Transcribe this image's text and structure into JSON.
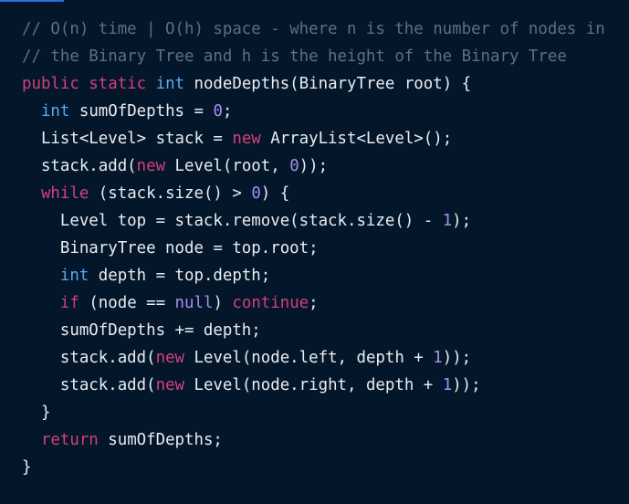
{
  "colors": {
    "background": "#04162a",
    "accent_bar": "#2a6fd6",
    "comment": "#5f6f7f",
    "keyword": "#d2417a",
    "type": "#5aa8f0",
    "number": "#a88ef0",
    "plain": "#e9edf2"
  },
  "code": {
    "language": "java",
    "lines": [
      [
        {
          "type": "comment",
          "text": "// O(n) time | O(h) space - where n is the number of nodes in"
        }
      ],
      [
        {
          "type": "comment",
          "text": "// the Binary Tree and h is the height of the Binary Tree"
        }
      ],
      [
        {
          "type": "keyword",
          "text": "public static "
        },
        {
          "type": "type",
          "text": "int"
        },
        {
          "type": "plain",
          "text": " nodeDepths(BinaryTree root) {"
        }
      ],
      [
        {
          "type": "plain",
          "text": "  "
        },
        {
          "type": "type",
          "text": "int"
        },
        {
          "type": "plain",
          "text": " sumOfDepths = "
        },
        {
          "type": "number",
          "text": "0"
        },
        {
          "type": "plain",
          "text": ";"
        }
      ],
      [
        {
          "type": "plain",
          "text": "  List<Level> stack = "
        },
        {
          "type": "keyword",
          "text": "new"
        },
        {
          "type": "plain",
          "text": " ArrayList<Level>();"
        }
      ],
      [
        {
          "type": "plain",
          "text": "  stack.add("
        },
        {
          "type": "keyword",
          "text": "new"
        },
        {
          "type": "plain",
          "text": " Level(root, "
        },
        {
          "type": "number",
          "text": "0"
        },
        {
          "type": "plain",
          "text": "));"
        }
      ],
      [
        {
          "type": "plain",
          "text": "  "
        },
        {
          "type": "keyword",
          "text": "while"
        },
        {
          "type": "plain",
          "text": " (stack.size() > "
        },
        {
          "type": "number",
          "text": "0"
        },
        {
          "type": "plain",
          "text": ") {"
        }
      ],
      [
        {
          "type": "plain",
          "text": "    Level top = stack.remove(stack.size() - "
        },
        {
          "type": "number",
          "text": "1"
        },
        {
          "type": "plain",
          "text": ");"
        }
      ],
      [
        {
          "type": "plain",
          "text": "    BinaryTree node = top.root;"
        }
      ],
      [
        {
          "type": "plain",
          "text": "    "
        },
        {
          "type": "type",
          "text": "int"
        },
        {
          "type": "plain",
          "text": " depth = top.depth;"
        }
      ],
      [
        {
          "type": "plain",
          "text": "    "
        },
        {
          "type": "keyword",
          "text": "if"
        },
        {
          "type": "plain",
          "text": " (node == "
        },
        {
          "type": "number",
          "text": "null"
        },
        {
          "type": "plain",
          "text": ") "
        },
        {
          "type": "keyword",
          "text": "continue"
        },
        {
          "type": "plain",
          "text": ";"
        }
      ],
      [
        {
          "type": "plain",
          "text": "    sumOfDepths += depth;"
        }
      ],
      [
        {
          "type": "plain",
          "text": "    stack.add("
        },
        {
          "type": "keyword",
          "text": "new"
        },
        {
          "type": "plain",
          "text": " Level(node.left, depth + "
        },
        {
          "type": "number",
          "text": "1"
        },
        {
          "type": "plain",
          "text": "));"
        }
      ],
      [
        {
          "type": "plain",
          "text": "    stack.add("
        },
        {
          "type": "keyword",
          "text": "new"
        },
        {
          "type": "plain",
          "text": " Level(node.right, depth + "
        },
        {
          "type": "number",
          "text": "1"
        },
        {
          "type": "plain",
          "text": "));"
        }
      ],
      [
        {
          "type": "plain",
          "text": "  }"
        }
      ],
      [
        {
          "type": "plain",
          "text": "  "
        },
        {
          "type": "keyword",
          "text": "return"
        },
        {
          "type": "plain",
          "text": " sumOfDepths;"
        }
      ],
      [
        {
          "type": "plain",
          "text": "}"
        }
      ]
    ]
  }
}
